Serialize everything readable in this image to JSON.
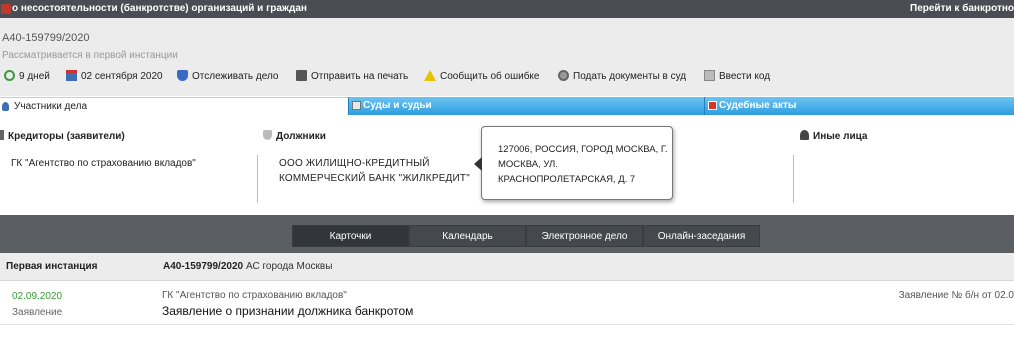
{
  "header": {
    "title": "о несостоятельности (банкротстве) организаций и граждан",
    "goto_link": "Перейти к банкротно"
  },
  "case": {
    "number": "А40-159799/2020",
    "status": "Рассматривается в первой инстанции"
  },
  "toolbar": {
    "days": "9 дней",
    "date": "02 сентября 2020",
    "track": "Отслеживать дело",
    "print": "Отправить на печать",
    "report_error": "Сообщить об ошибке",
    "submit_docs": "Подать документы в суд",
    "enter_code": "Ввести код"
  },
  "tabs": [
    {
      "label": "Участники дела"
    },
    {
      "label": "Суды и судьи"
    },
    {
      "label": "Судебные акты"
    }
  ],
  "parties": {
    "creditors_header": "Кредиторы (заявители)",
    "creditor_name": "ГК \"Агентство по страхованию вкладов\"",
    "debtors_header": "Должники",
    "debtor_name": "ООО ЖИЛИЩНО-КРЕДИТНЫЙ КОММЕРЧЕСКИЙ БАНК \"ЖИЛКРЕДИТ\"",
    "others_header": "Иные лица"
  },
  "tooltip": {
    "address": "127006, РОССИЯ, ГОРОД МОСКВА, Г. МОСКВА, УЛ. КРАСНОПРОЛЕТАРСКАЯ, Д. 7"
  },
  "subtabs": [
    {
      "label": "Карточки"
    },
    {
      "label": "Календарь"
    },
    {
      "label": "Электронное дело"
    },
    {
      "label": "Онлайн-заседания"
    }
  ],
  "instance": {
    "label": "Первая инстанция",
    "case_number": "А40-159799/2020",
    "court": "АС города Москвы"
  },
  "document": {
    "date": "02.09.2020",
    "kind": "Заявление",
    "party": "ГК \"Агентство по страхованию вкладов\"",
    "title": "Заявление о признании должника банкротом",
    "reference": "Заявление № б/н от 02.0"
  },
  "colors": {
    "topbar": "#4a4d52",
    "tab_blue": "#2e9ee0",
    "dark_bar": "#5a5d62",
    "date_green": "#3a9a3a"
  }
}
